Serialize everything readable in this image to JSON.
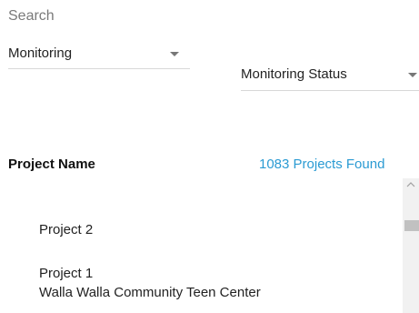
{
  "search": {
    "label": "Search"
  },
  "filters": {
    "monitoring": {
      "selected": "Monitoring"
    },
    "monitoring_status": {
      "selected": "Monitoring Status"
    }
  },
  "table": {
    "column_header": "Project Name",
    "count_text": "1083 Projects Found",
    "items": [
      {
        "label": "Project 2"
      },
      {
        "label": "Project 1"
      },
      {
        "label": "Walla Walla Community Teen Center"
      }
    ]
  },
  "colors": {
    "accent": "#2b9bd3"
  }
}
